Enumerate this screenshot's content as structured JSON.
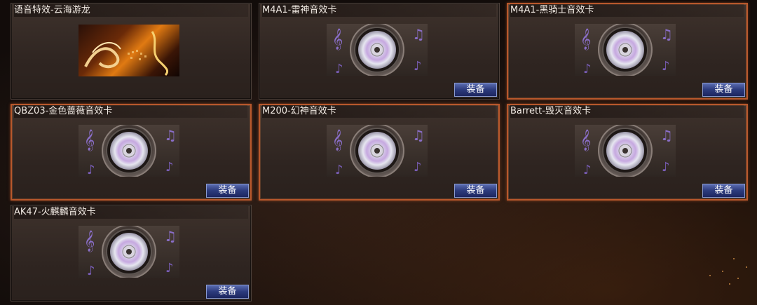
{
  "cards": [
    {
      "title": "语音特效-云海游龙",
      "thumb": "dragon-image"
    },
    {
      "title": "M4A1-雷神音效卡",
      "thumb": "music-disc-icon",
      "button": "装备"
    },
    {
      "title": "M4A1-黑骑士音效卡",
      "thumb": "music-disc-icon",
      "button": "装备"
    },
    {
      "title": "QBZ03-金色蔷薇音效卡",
      "thumb": "music-disc-icon",
      "button": "装备"
    },
    {
      "title": "M200-幻神音效卡",
      "thumb": "music-disc-icon",
      "button": "装备"
    },
    {
      "title": "Barrett-毁灭音效卡",
      "thumb": "music-disc-icon",
      "button": "装备"
    },
    {
      "title": "AK47-火麒麟音效卡",
      "thumb": "music-disc-icon",
      "button": "装备"
    }
  ],
  "colors": {
    "selected_border": "#b8582c",
    "button_blue": "#2c3a7c",
    "disc_purple": "#8a6ec8"
  }
}
